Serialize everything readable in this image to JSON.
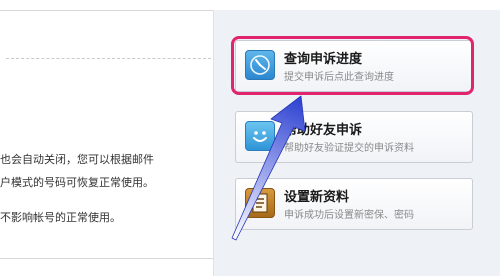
{
  "left_panel": {
    "line_1": "也会自动关闭，您可以根据邮件",
    "line_2": "户模式的号码可恢复正常使用。",
    "line_3": "不影响帐号的正常使用。"
  },
  "options": [
    {
      "title": "查询申诉进度",
      "subtitle": "提交申诉后点此查询进度",
      "icon": "clock-icon"
    },
    {
      "title": "帮助好友申诉",
      "subtitle": "帮助好友验证提交的申诉资料",
      "icon": "smile-icon"
    },
    {
      "title": "设置新资料",
      "subtitle": "申诉成功后设置新密保、密码",
      "icon": "form-icon"
    }
  ],
  "colors": {
    "highlight": "#e0246e",
    "arrow_start": "#ffffff",
    "arrow_end": "#2a3fd0"
  }
}
